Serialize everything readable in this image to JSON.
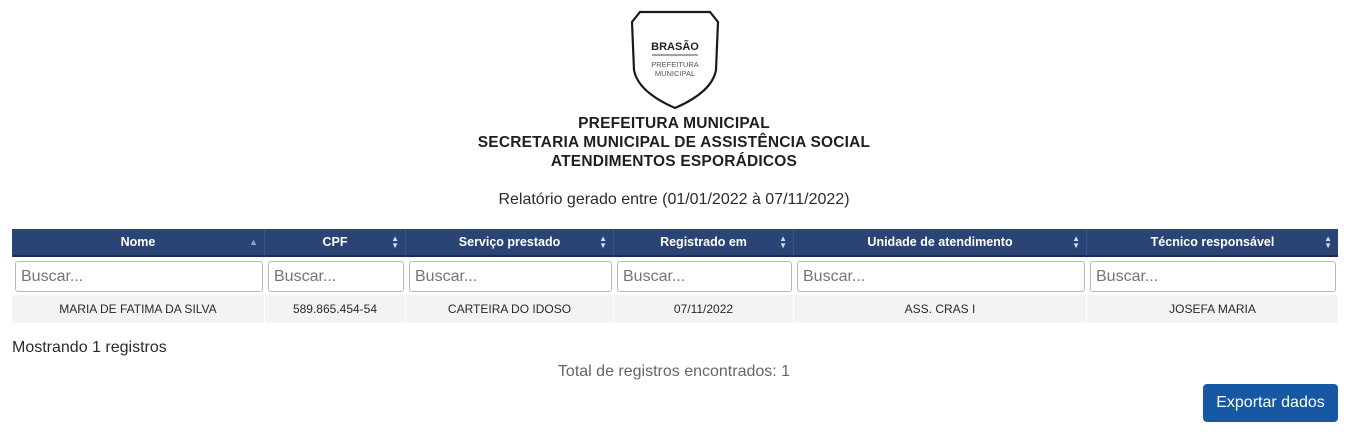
{
  "header": {
    "crest": {
      "title": "BRASÃO",
      "line1": "PREFEITURA",
      "line2": "MUNICIPAL"
    },
    "title_line1": "PREFEITURA MUNICIPAL",
    "title_line2": "SECRETARIA MUNICIPAL DE ASSISTÊNCIA SOCIAL",
    "title_line3": "ATENDIMENTOS ESPORÁDICOS",
    "period": "Relatório gerado entre (01/01/2022 à 07/11/2022)"
  },
  "table": {
    "columns": [
      {
        "label": "Nome",
        "sort": "asc"
      },
      {
        "label": "CPF",
        "sort": "none"
      },
      {
        "label": "Serviço prestado",
        "sort": "none"
      },
      {
        "label": "Registrado em",
        "sort": "none"
      },
      {
        "label": "Unidade de atendimento",
        "sort": "none"
      },
      {
        "label": "Técnico responsável",
        "sort": "none"
      }
    ],
    "filter_placeholder": "Buscar...",
    "rows": [
      [
        "MARIA DE FATIMA DA SILVA",
        "589.865.454-54",
        "CARTEIRA DO IDOSO",
        "07/11/2022",
        "ASS. CRAS I",
        "JOSEFA MARIA"
      ]
    ]
  },
  "footer": {
    "showing": "Mostrando 1 registros",
    "total": "Total de registros encontrados: 1",
    "export_label": "Exportar dados"
  },
  "colors": {
    "header_bg": "#2a4476",
    "button_bg": "#1658a3",
    "row_bg": "#f3f3f3"
  }
}
